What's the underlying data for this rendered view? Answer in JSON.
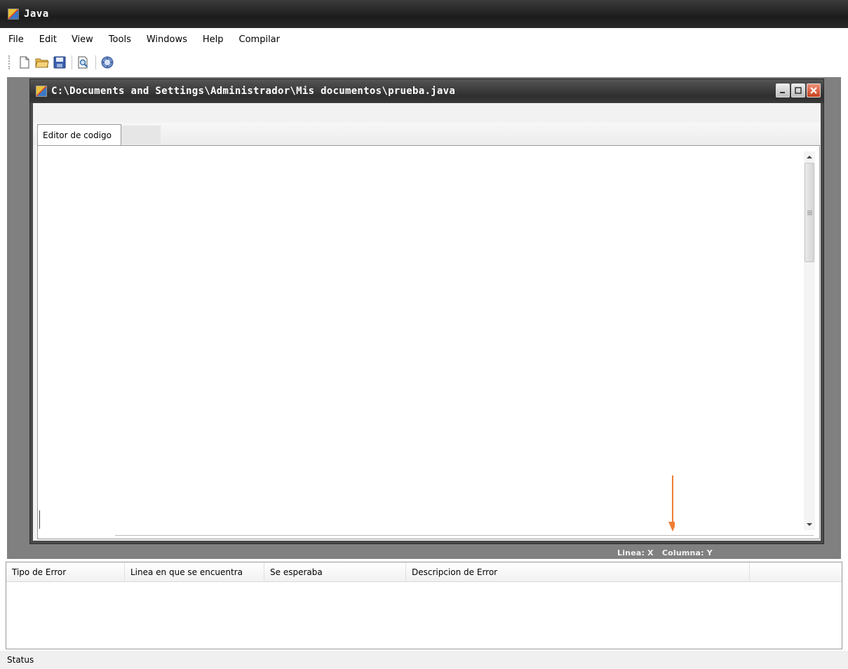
{
  "window": {
    "title": "Java"
  },
  "menu": [
    {
      "label": "File"
    },
    {
      "label": "Edit"
    },
    {
      "label": "View"
    },
    {
      "label": "Tools"
    },
    {
      "label": "Windows"
    },
    {
      "label": "Help"
    },
    {
      "label": "Compilar"
    }
  ],
  "toolbar": {
    "icons": [
      "new-file-icon",
      "open-folder-icon",
      "save-icon",
      "print-preview-icon",
      "compile-icon"
    ]
  },
  "child_window": {
    "title": "C:\\Documents and Settings\\Administrador\\Mis documentos\\prueba.java",
    "tab_label": "Editor de codigo"
  },
  "cursor_status": {
    "linea": "Linea: X",
    "columna": "Columna: Y"
  },
  "errors_table": {
    "columns": [
      "Tipo de Error",
      "Linea en que se encuentra",
      "Se esperaba",
      "Descripcion de Error",
      ""
    ],
    "rows": []
  },
  "status_bar": {
    "text": "Status"
  },
  "colors": {
    "title_bar": "#2a2a2a",
    "mdi_background": "#808080",
    "annotation_arrow": "#ee7d33"
  }
}
